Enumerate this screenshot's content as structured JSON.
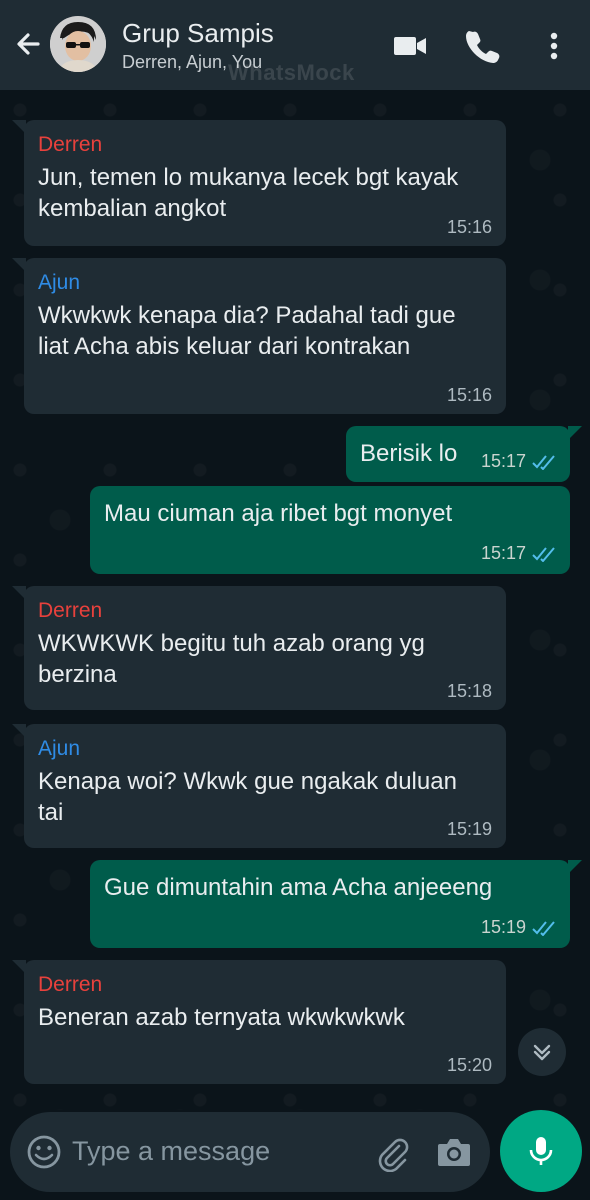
{
  "header": {
    "title": "Grup Sampis",
    "subtitle": "Derren, Ajun, You",
    "watermark": "WhatsMock"
  },
  "icons": {
    "back": "arrow-left-icon",
    "video": "video-camera-icon",
    "call": "phone-icon",
    "menu": "more-vertical-icon",
    "scroll": "chevron-double-down-icon",
    "emoji": "emoji-icon",
    "attach": "paperclip-icon",
    "camera": "camera-icon",
    "mic": "microphone-icon"
  },
  "colors": {
    "derren": "#e8413c",
    "ajun": "#2f8ce6",
    "outgoing_bubble": "#005c4b",
    "incoming_bubble": "#1f2c34",
    "read_tick": "#53bdeb",
    "accent": "#00a884"
  },
  "messages": [
    {
      "sender": "Derren",
      "text": "Jun, temen lo mukanya lecek bgt kayak kembalian angkot",
      "time": "15:16"
    },
    {
      "sender": "Ajun",
      "text": "Wkwkwk kenapa dia? Padahal tadi gue liat Acha abis keluar dari kontrakan",
      "time": "15:16"
    },
    {
      "text": "Berisik lo",
      "time": "15:17",
      "status": "read"
    },
    {
      "text": "Mau ciuman aja ribet bgt monyet",
      "time": "15:17",
      "status": "read"
    },
    {
      "sender": "Derren",
      "text": "WKWKWK begitu tuh azab orang yg berzina",
      "time": "15:18"
    },
    {
      "sender": "Ajun",
      "text": "Kenapa woi? Wkwk gue ngakak duluan tai",
      "time": "15:19"
    },
    {
      "text": "Gue dimuntahin ama Acha anjeeeng",
      "time": "15:19",
      "status": "read"
    },
    {
      "sender": "Derren",
      "text": "Beneran azab ternyata wkwkwkwk",
      "time": "15:20"
    }
  ],
  "input": {
    "placeholder": "Type a message"
  }
}
